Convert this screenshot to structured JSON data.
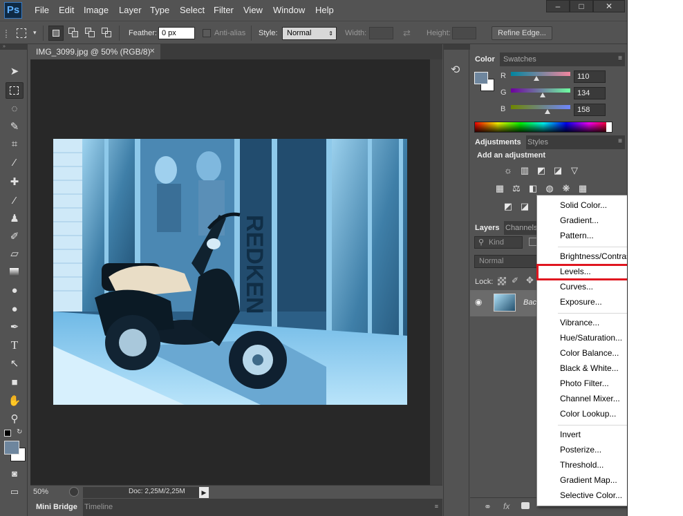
{
  "app": {
    "logo": "Ps"
  },
  "menubar": {
    "items": [
      "File",
      "Edit",
      "Image",
      "Layer",
      "Type",
      "Select",
      "Filter",
      "View",
      "Window",
      "Help"
    ]
  },
  "window_controls": {
    "minimize": "–",
    "maximize": "□",
    "close": "✕"
  },
  "options_bar": {
    "feather_label": "Feather:",
    "feather_value": "0 px",
    "antialias_label": "Anti-alias",
    "style_label": "Style:",
    "style_value": "Normal",
    "width_label": "Width:",
    "height_label": "Height:",
    "refine_edge": "Refine Edge..."
  },
  "document": {
    "tab_title": "IMG_3099.jpg @ 50% (RGB/8)",
    "tab_close": "✕",
    "zoom": "50%",
    "doc_info": "Doc: 2,25M/2,25M"
  },
  "bottom_tabs": [
    "Mini Bridge",
    "Timeline"
  ],
  "color_panel": {
    "tabs": [
      "Color",
      "Swatches"
    ],
    "r_label": "R",
    "g_label": "G",
    "b_label": "B",
    "r": "110",
    "g": "134",
    "b": "158",
    "r_fraction": 0.43,
    "g_fraction": 0.53,
    "b_fraction": 0.62
  },
  "adjustments_panel": {
    "tabs": [
      "Adjustments",
      "Styles"
    ],
    "heading": "Add an adjustment"
  },
  "layers_panel": {
    "tabs": [
      "Layers",
      "Channels"
    ],
    "kind_filter": "Kind",
    "blend_mode": "Normal",
    "lock_label": "Lock:",
    "layer_name": "Back"
  },
  "dropdown_menu": {
    "groups": [
      [
        "Solid Color...",
        "Gradient...",
        "Pattern..."
      ],
      [
        "Brightness/Contrast...",
        "Levels...",
        "Curves...",
        "Exposure..."
      ],
      [
        "Vibrance...",
        "Hue/Saturation...",
        "Color Balance...",
        "Black & White...",
        "Photo Filter...",
        "Channel Mixer...",
        "Color Lookup..."
      ],
      [
        "Invert",
        "Posterize...",
        "Threshold...",
        "Gradient Map...",
        "Selective Color..."
      ]
    ],
    "highlighted": "Levels..."
  },
  "colors": {
    "highlight_box": "#e0161f",
    "foreground": "#6e869e"
  }
}
